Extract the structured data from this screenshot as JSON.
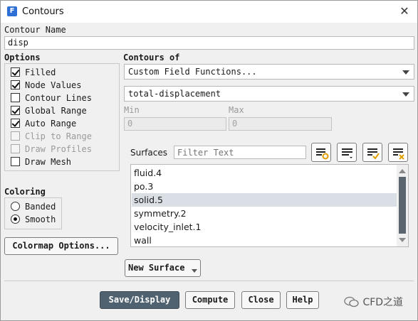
{
  "window": {
    "title": "Contours",
    "app_icon": "F"
  },
  "contour_name": {
    "label": "Contour Name",
    "value": "disp"
  },
  "options": {
    "label": "Options",
    "items": [
      {
        "label": "Filled",
        "checked": true,
        "enabled": true
      },
      {
        "label": "Node Values",
        "checked": true,
        "enabled": true
      },
      {
        "label": "Contour Lines",
        "checked": false,
        "enabled": true
      },
      {
        "label": "Global Range",
        "checked": true,
        "enabled": true
      },
      {
        "label": "Auto Range",
        "checked": true,
        "enabled": true
      },
      {
        "label": "Clip to Range",
        "checked": false,
        "enabled": false
      },
      {
        "label": "Draw Profiles",
        "checked": false,
        "enabled": false
      },
      {
        "label": "Draw Mesh",
        "checked": false,
        "enabled": true
      }
    ]
  },
  "coloring": {
    "label": "Coloring",
    "options": [
      {
        "label": "Banded",
        "selected": false
      },
      {
        "label": "Smooth",
        "selected": true
      }
    ]
  },
  "colormap_button": "Colormap Options...",
  "contours_of": {
    "label": "Contours of",
    "category": "Custom Field Functions...",
    "field": "total-displacement"
  },
  "range": {
    "min_label": "Min",
    "min_value": "0",
    "max_label": "Max",
    "max_value": "0"
  },
  "surfaces": {
    "label": "Surfaces",
    "filter_placeholder": "Filter Text",
    "items": [
      {
        "label": "fluid.4",
        "selected": false
      },
      {
        "label": "po.3",
        "selected": false
      },
      {
        "label": "solid.5",
        "selected": true
      },
      {
        "label": "symmetry.2",
        "selected": false
      },
      {
        "label": "velocity_inlet.1",
        "selected": false
      },
      {
        "label": "wall",
        "selected": false
      }
    ],
    "tool_icons": [
      "filter-surface-type-icon",
      "list-lines-icon",
      "select-all-icon",
      "deselect-all-icon"
    ]
  },
  "new_surface_button": "New Surface",
  "buttons": {
    "save_display": "Save/Display",
    "compute": "Compute",
    "close": "Close",
    "help": "Help"
  },
  "watermark": "CFD之道",
  "colors": {
    "primary_button": "#506270",
    "selection": "#d9dfe5",
    "scroll_thumb": "#5a6570"
  }
}
